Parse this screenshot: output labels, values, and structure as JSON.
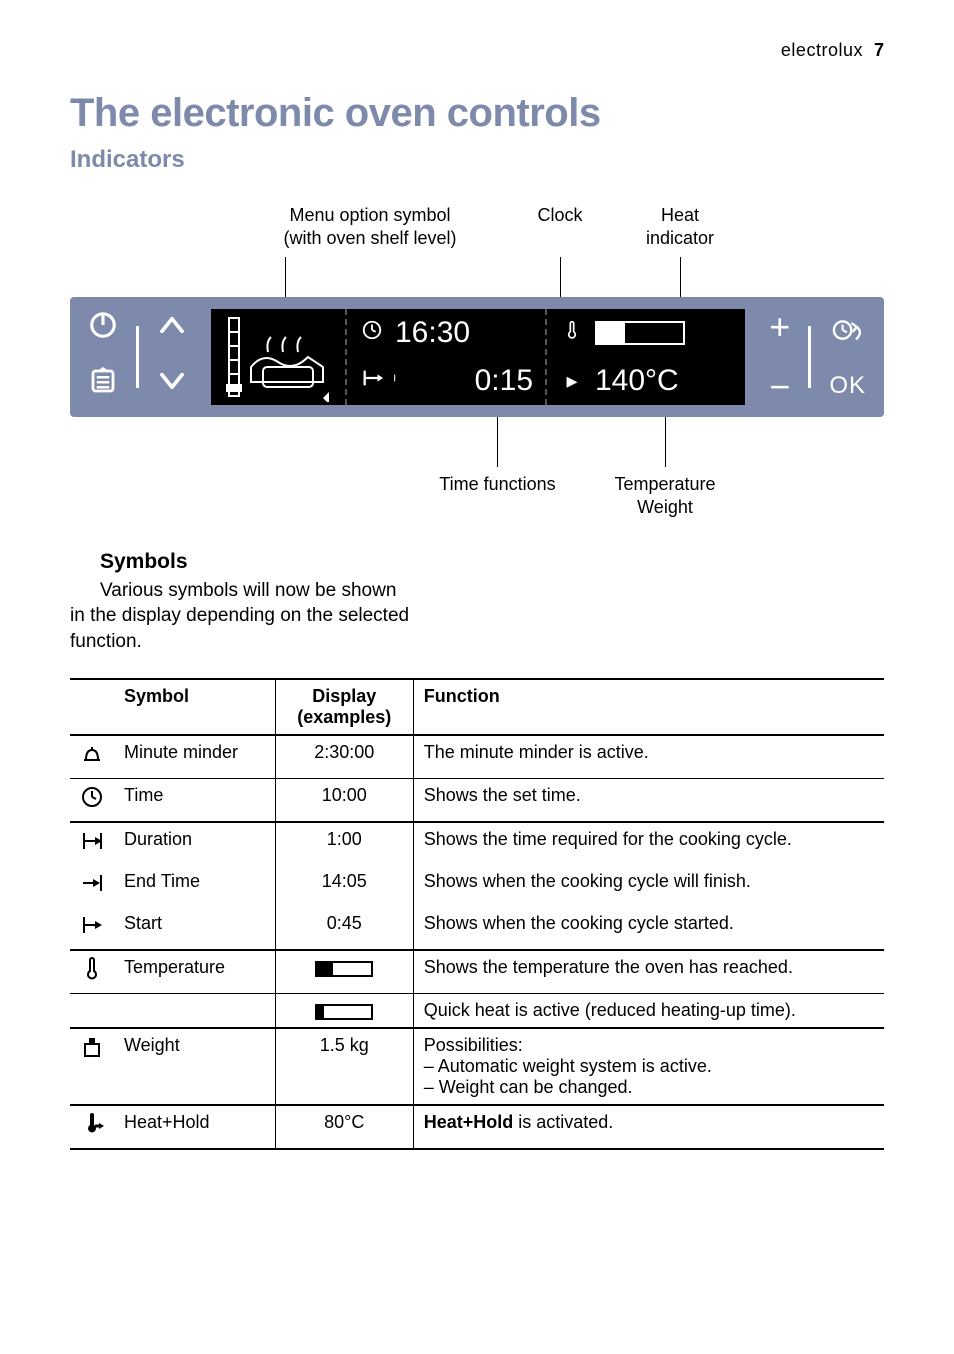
{
  "header": {
    "brand": "electrolux",
    "page_number": "7"
  },
  "title": "The electronic oven controls",
  "subtitle": "Indicators",
  "diagram": {
    "top_labels": {
      "menu_option": {
        "line1": "Menu option symbol",
        "line2": "(with oven shelf level)"
      },
      "clock": "Clock",
      "heat": {
        "line1": "Heat",
        "line2": "indicator"
      }
    },
    "screen": {
      "clock_value": "16:30",
      "timer_value": "0:15",
      "temperature_value": "140°C"
    },
    "right_group": {
      "ok_label": "OK"
    },
    "bottom_labels": {
      "time_functions": "Time functions",
      "temp_weight": {
        "line1": "Temperature",
        "line2": "Weight"
      }
    }
  },
  "symbols_section": {
    "heading": "Symbols",
    "paragraph": "Various symbols will now be shown in the display depending on the selected function."
  },
  "table": {
    "headers": {
      "symbol": "Symbol",
      "display": "Display",
      "display_sub": "(examples)",
      "function": "Function"
    },
    "rows": [
      {
        "icon": "bell",
        "name": "Minute minder",
        "bold": false,
        "display": "2:30:00",
        "func": "The minute minder is active."
      },
      {
        "icon": "clock",
        "name": "Time",
        "bold": false,
        "display": "10:00",
        "func": "Shows the set time."
      },
      {
        "icon": "dur",
        "name": "Duration",
        "bold": true,
        "display": "1:00",
        "func": "Shows the time required for the cooking cycle."
      },
      {
        "icon": "end",
        "name": "End Time",
        "bold": true,
        "display": "14:05",
        "func": "Shows when the cooking cycle will finish."
      },
      {
        "icon": "start",
        "name": "Start",
        "bold": false,
        "display": "0:45",
        "func": "Shows when the cooking cycle started."
      },
      {
        "icon": "temp",
        "name": "Temperature",
        "bold": false,
        "display": "bar",
        "func": "Shows the temperature the oven has reached."
      },
      {
        "icon": "",
        "name": "",
        "bold": false,
        "display": "barlow",
        "func": "Quick heat is active (reduced heating-up time)."
      },
      {
        "icon": "weight",
        "name": "Weight",
        "bold": false,
        "display": "1.5 kg",
        "func": "Possibilities:\n– Automatic weight system is active.\n– Weight can be changed."
      },
      {
        "icon": "heathold",
        "name": "Heat+Hold",
        "bold": true,
        "display": "80°C",
        "func": "Heat+Hold is activated."
      }
    ]
  }
}
